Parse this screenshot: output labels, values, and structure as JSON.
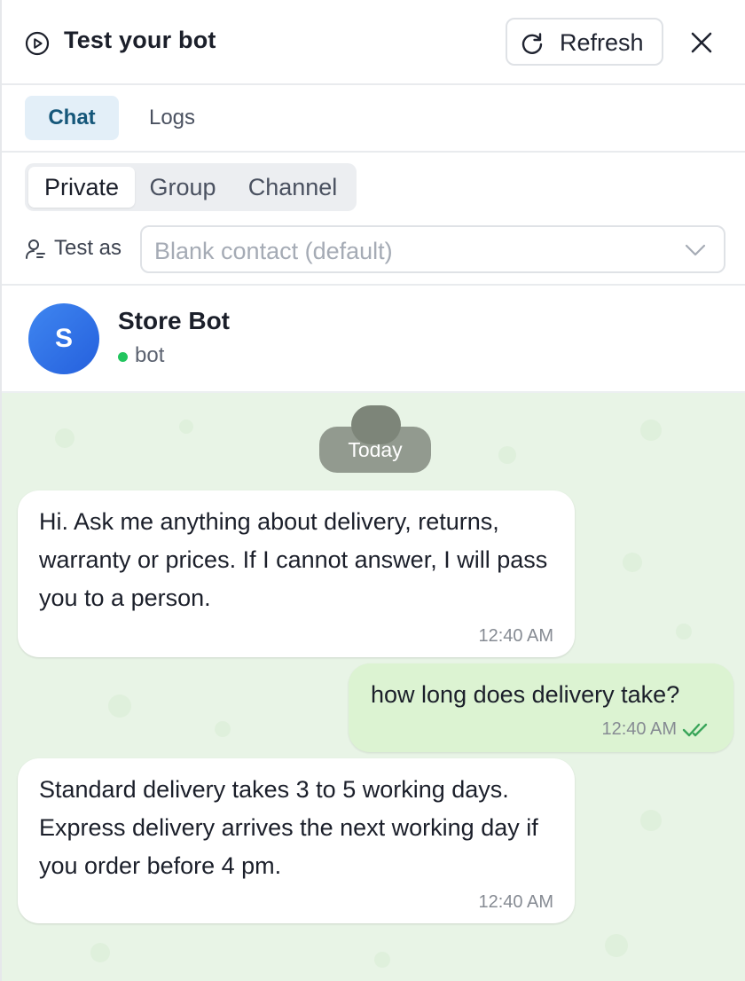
{
  "header": {
    "title": "Test your bot",
    "refresh_label": "Refresh"
  },
  "tabs": [
    {
      "label": "Chat",
      "active": true
    },
    {
      "label": "Logs",
      "active": false
    }
  ],
  "chat_type": {
    "options": [
      "Private",
      "Group",
      "Channel"
    ],
    "selected": "Private"
  },
  "test_as": {
    "label": "Test as",
    "placeholder": "Blank contact (default)"
  },
  "bot": {
    "initial": "S",
    "name": "Store Bot",
    "status": "bot"
  },
  "chat": {
    "date_label": "Today",
    "messages": [
      {
        "direction": "incoming",
        "text": "Hi. Ask me anything about delivery, returns, warranty or prices. If I cannot answer, I will pass you to a person.",
        "time": "12:40 AM"
      },
      {
        "direction": "outgoing",
        "text": "how long does delivery take?",
        "time": "12:40 AM",
        "read": true
      },
      {
        "direction": "incoming",
        "text": "Standard delivery takes 3 to 5 working days. Express delivery arrives the next working day if you order before 4 pm.",
        "time": "12:40 AM"
      }
    ]
  },
  "icons": {
    "title": "play-circle-icon",
    "refresh": "refresh-icon",
    "close": "close-icon",
    "test_as": "user-icon",
    "dropdown": "chevron-down-icon",
    "read_receipt": "double-check-icon"
  },
  "colors": {
    "active_tab_bg": "#e3eff8",
    "active_tab_text": "#15577a",
    "avatar": "#2f6fe8",
    "online": "#22c55e",
    "chat_bg": "#e8f4e6",
    "outgoing_bubble": "#dcf3d2",
    "read_tick": "#3aa55a"
  }
}
